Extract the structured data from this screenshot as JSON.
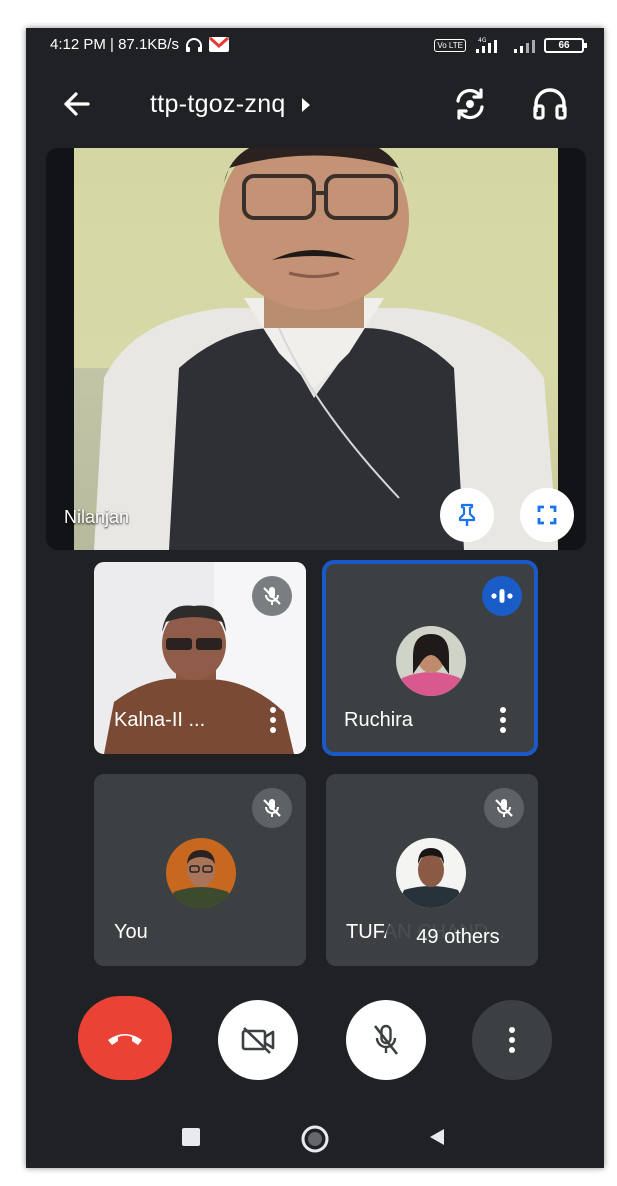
{
  "status_bar": {
    "time_speed": "4:12 PM | 87.1KB/s",
    "volte_label": "Vo LTE",
    "network": "4G",
    "battery": "66"
  },
  "header": {
    "meeting_code": "ttp-tgoz-znq"
  },
  "main_tile": {
    "name": "Nilanjan"
  },
  "participants": [
    {
      "name": "Kalna-II ...",
      "muted": true,
      "speaking": false
    },
    {
      "name": "Ruchira",
      "muted": false,
      "speaking": true
    },
    {
      "name": "You",
      "muted": true,
      "speaking": false
    },
    {
      "name": "TUFAN CHAND...",
      "muted": true,
      "speaking": false
    }
  ],
  "others_chip": "49 others",
  "controls": [
    "end-call",
    "camera-off",
    "mic-off",
    "more-options"
  ],
  "colors": {
    "background": "#202124",
    "tile": "#3c4043",
    "hangup": "#ea4335",
    "active_speaker": "#1a59c7"
  }
}
